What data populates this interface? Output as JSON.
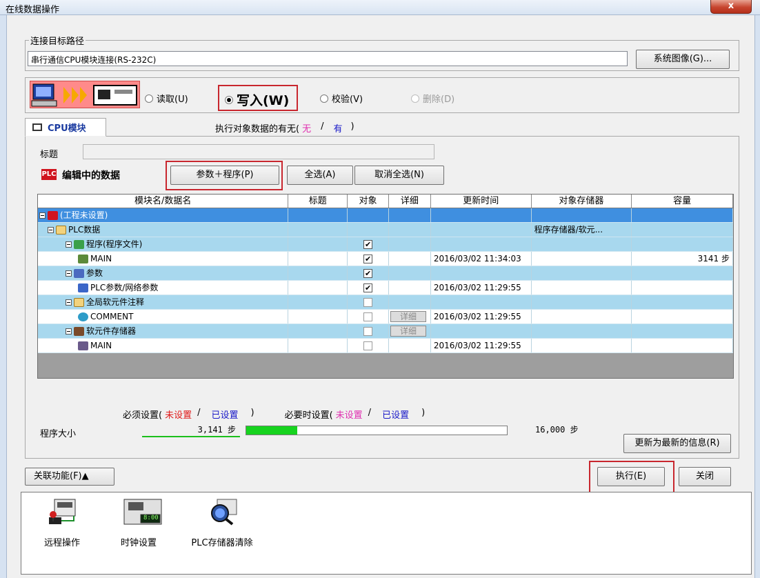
{
  "window": {
    "title": "在线数据操作",
    "close_label": "x"
  },
  "connection": {
    "legend": "连接目标路径",
    "path": "串行通信CPU模块连接(RS-232C)",
    "system_image_button": "系统图像(G)..."
  },
  "mode": {
    "read": "读取(U)",
    "write": "写入(W)",
    "verify": "校验(V)",
    "delete": "删除(D)",
    "selected": "write"
  },
  "tab": {
    "label": "CPU模块"
  },
  "existence": {
    "prefix": "执行对象数据的有无(",
    "none": "无",
    "sep": "/",
    "has": "有",
    "suffix": ")"
  },
  "title_field": {
    "label": "标题",
    "value": ""
  },
  "editing": {
    "label": "编辑中的数据",
    "param_program_button": "参数＋程序(P)",
    "select_all_button": "全选(A)",
    "deselect_all_button": "取消全选(N)"
  },
  "table": {
    "headers": [
      "模块名/数据名",
      "标题",
      "对象",
      "详细",
      "更新时间",
      "对象存储器",
      "容量"
    ],
    "rows": [
      {
        "name": "(工程未设置)",
        "title": "",
        "target": "",
        "detail": "",
        "time": "",
        "memory": "",
        "capacity": ""
      },
      {
        "name": "PLC数据",
        "title": "",
        "target": "",
        "detail": "",
        "time": "",
        "memory": "程序存储器/软元...",
        "capacity": ""
      },
      {
        "name": "程序(程序文件)",
        "title": "",
        "target": "checked",
        "detail": "",
        "time": "",
        "memory": "",
        "capacity": ""
      },
      {
        "name": "MAIN",
        "title": "",
        "target": "checked",
        "detail": "",
        "time": "2016/03/02 11:34:03",
        "memory": "",
        "capacity": "3141 步"
      },
      {
        "name": "参数",
        "title": "",
        "target": "checked",
        "detail": "",
        "time": "",
        "memory": "",
        "capacity": ""
      },
      {
        "name": "PLC参数/网络参数",
        "title": "",
        "target": "checked",
        "detail": "",
        "time": "2016/03/02 11:29:55",
        "memory": "",
        "capacity": ""
      },
      {
        "name": "全局软元件注释",
        "title": "",
        "target": "unchecked",
        "detail": "",
        "time": "",
        "memory": "",
        "capacity": ""
      },
      {
        "name": "COMMENT",
        "title": "",
        "target": "unchecked",
        "detail": "详细",
        "time": "2016/03/02 11:29:55",
        "memory": "",
        "capacity": ""
      },
      {
        "name": "软元件存储器",
        "title": "",
        "target": "unchecked",
        "detail": "详细",
        "time": "",
        "memory": "",
        "capacity": ""
      },
      {
        "name": "MAIN",
        "title": "",
        "target": "unchecked",
        "detail": "",
        "time": "2016/03/02 11:29:55",
        "memory": "",
        "capacity": ""
      }
    ]
  },
  "settings_legend": {
    "required_prefix": "必须设置(",
    "not_set": "未设置",
    "slash": "/",
    "set": "已设置",
    "close_paren": ")",
    "optional_prefix": "必要时设置(",
    "opt_not_set": "未设置",
    "opt_slash": "/",
    "opt_set": "已设置",
    "opt_close": ")"
  },
  "program_size": {
    "label": "程序大小",
    "value": "3,141 步",
    "max": "16,000 步",
    "fraction": 0.196
  },
  "buttons": {
    "refresh": "更新为最新的信息(R)",
    "related": "关联功能(F)▲",
    "execute": "执行(E)",
    "close": "关闭"
  },
  "tools": [
    {
      "label": "远程操作",
      "icon": "remote-operation-icon"
    },
    {
      "label": "时钟设置",
      "icon": "clock-setting-icon",
      "display": "8:00"
    },
    {
      "label": "PLC存储器清除",
      "icon": "memory-clear-icon"
    }
  ],
  "colors": {
    "selected_row": "#3f8fe0",
    "group_row": "#a8d8ee",
    "highlight_box": "#c8262e",
    "progress": "#17d31f"
  }
}
